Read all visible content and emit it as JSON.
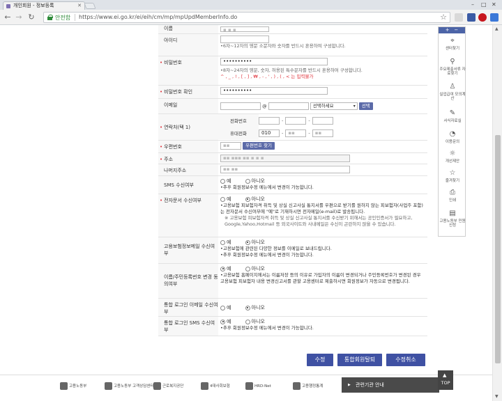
{
  "browser": {
    "tab_title": "개인회원 - 정보등록",
    "secure_label": "안전함",
    "url": "https://www.ei.go.kr/ei/eih/cm/mp/mpUpdMemberInfo.do"
  },
  "form": {
    "name_label": "이름",
    "id_label": "아이디",
    "id_help": "6자~12자의 영문 소문자와 숫자를 반드시 혼용하여 구성합니다.",
    "pw_label": "비밀번호",
    "pw_value": "••••••••••",
    "pw_help": "8자~24자의 영문, 숫자, 허용된 특수문자를 반드시 혼용하여 구성합니다.",
    "pw_special": "^ , _ , ! , [ , ] , ₩ , - , ' , ) , ( , < 는 입력불가",
    "pw_confirm_label": "비밀번호 확인",
    "pw_confirm_value": "••••••••••",
    "email_label": "이메일",
    "email_at": "@",
    "email_select": "선택하세요",
    "email_select_btn": "선택",
    "contact_label": "연락처(택 1)",
    "phone_label": "전화번호",
    "mobile_label": "휴대전화",
    "mobile_prefix": "010",
    "zipcode_label": "우편번호",
    "zipcode_btn": "우편번호 찾기",
    "address_label": "주소",
    "address_detail_label": "나머지주소",
    "sms_label": "SMS 수신여부",
    "yes": "예",
    "no": "아니오",
    "sms_note": "추후 회원정보수정 메뉴에서 변경이 가능합니다.",
    "edoc_label": "전자문서 수신여부",
    "edoc_note1": "고용보험 피보험자격 취득 및 상실 신고사실 통지서를 우편으로 받기를 원하지 않는 피보험자(사업주 포함)는 전자문서 수신여부에 \"예\"로 기재하시면 전자메일(e-mail)로 발송됩니다.",
    "edoc_note2": "※ 고용보험 피보험자격 취득 및 상실 신고사실 통지서를 수신받기 위해서는 공인인증서가 필요하고, Google,Yahoo,Hotmail 등 외국사이트와 사내메일은 수신이 곤란하지 않을 수 있습니다.",
    "ins_email_label": "고용보험정보메일 수신여부",
    "ins_email_note1": "고용보험에 관련된 다양한 정보를 이메일로 보내드립니다.",
    "ins_email_note2": "추후 회원정보수정 메뉴에서 변경이 가능합니다.",
    "name_change_label": "이름/주민등록번호 변경 동의여부",
    "name_change_note": "고용보험 홈페이지에서는 이름저장 등의 이유로 가입자의 이름이 변경되거나 주민등록번호가 변경된 경우 고용보험 피보험자 내용 변경신고서를 관할 고용센터로 제출하시면 회원정보가 자동으로 변경됩니다.",
    "integrated_email_label": "통합 로그인 이메일 수신여부",
    "integrated_sms_label": "통합 로그인 SMS 수신여부",
    "integrated_sms_note": "추후 회원정보수정 메뉴에서 변경이 가능합니다."
  },
  "actions": {
    "edit": "수정",
    "withdraw": "통합회원탈퇴",
    "cancel": "수정취소"
  },
  "footer": {
    "related": "관련기관 안내",
    "top": "TOP",
    "logos": [
      "고용노동부",
      "고용노동부 고객상담센터",
      "근로복지공단",
      "4대사회보험",
      "HRD-Net",
      "고용행정통계"
    ]
  },
  "quick_menu": {
    "items": [
      "센터찾기",
      "주요제출서류 자료찾기",
      "실업급여 모의계산",
      "서식자료실",
      "이용문의",
      "개선제안",
      "즐겨찾기",
      "인쇄",
      "고용노동부 민원신청"
    ]
  },
  "colors": {
    "primary_button": "#3f51a3",
    "required": "#e0323a",
    "secure": "#2e8b3a"
  }
}
